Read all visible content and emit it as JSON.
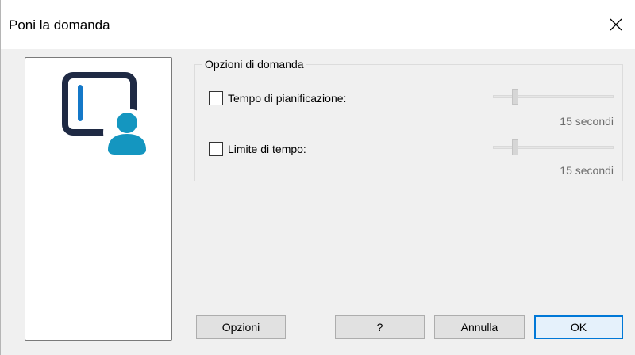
{
  "window": {
    "title": "Poni la domanda"
  },
  "group": {
    "legend": "Opzioni di domanda",
    "options": [
      {
        "label": "Tempo di pianificazione:",
        "checked": false,
        "value_text": "15 secondi",
        "level": 0.15
      },
      {
        "label": "Limite di tempo:",
        "checked": false,
        "value_text": "15 secondi",
        "level": 0.15
      }
    ]
  },
  "buttons": {
    "options": "Opzioni",
    "help": "?",
    "cancel": "Annulla",
    "ok": "OK"
  },
  "icons": {
    "close": "close-icon",
    "illustration": "ask-question-icon"
  },
  "colors": {
    "accent": "#0078d7",
    "icon_dark": "#1f2a44",
    "icon_teal": "#1496c0"
  }
}
